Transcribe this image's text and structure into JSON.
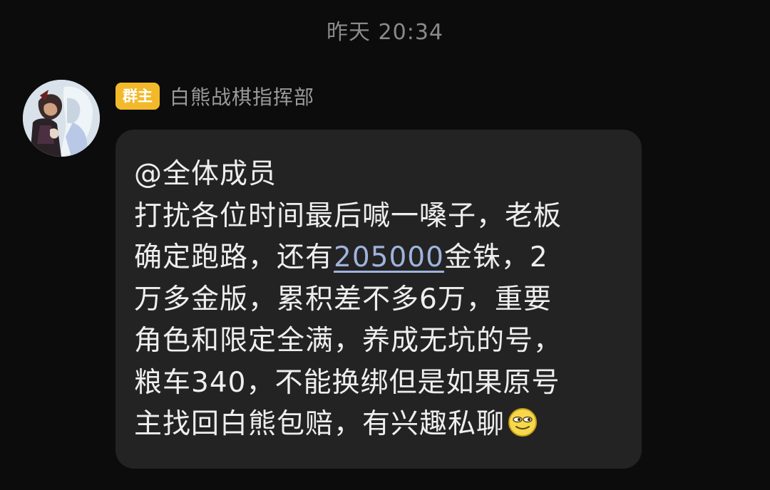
{
  "header": {
    "timestamp": "昨天 20:34"
  },
  "message": {
    "sender": {
      "role_badge": "群主",
      "name": "白熊战棋指挥部",
      "avatar_icon": "anime-avatar-icon"
    },
    "lines": {
      "l1": "@全体成员",
      "l2": "打扰各位时间最后喊一嗓子，老板",
      "l3_before": "确定跑路，还有",
      "l3_link": "205000",
      "l3_after": "金铢，2",
      "l4": "万多金版，累积差不多6万，重要",
      "l5": "角色和限定全满，养成无坑的号，",
      "l6": "粮车340，不能换绑但是如果原号",
      "l7": "主找回白熊包赔，有兴趣私聊"
    },
    "emoji_icon": "smug-face-emoji-icon"
  },
  "colors": {
    "background": "#0c0c0c",
    "bubble": "#232323",
    "badge": "#f2b92a",
    "link": "#9fb3dd"
  }
}
